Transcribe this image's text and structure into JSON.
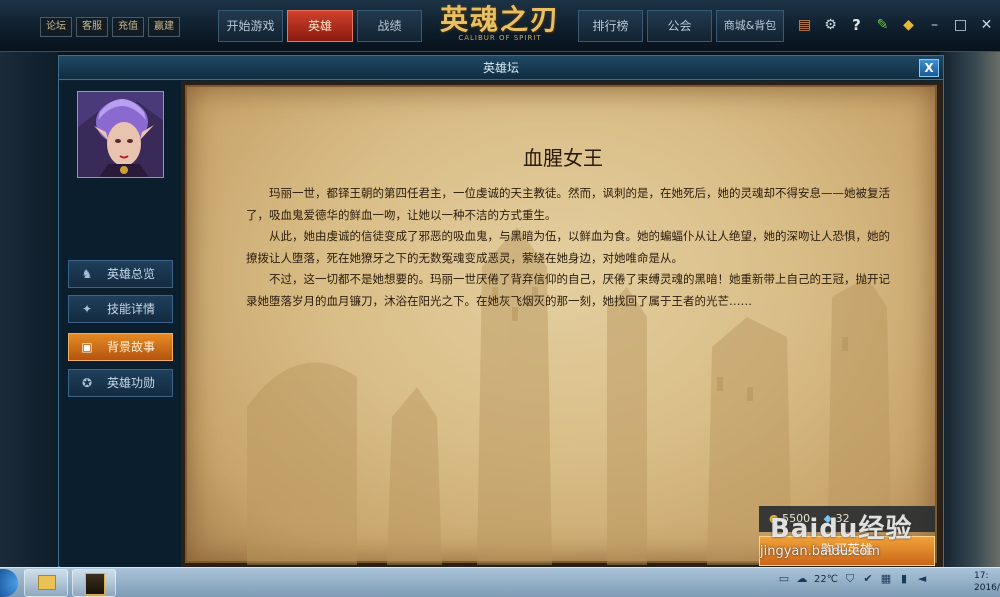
{
  "topbar": {
    "mini_links": [
      "论坛",
      "客服",
      "充值",
      "赢建"
    ],
    "tabs": [
      "开始游戏",
      "英雄",
      "战绩",
      "排行榜",
      "公会",
      "商城&背包"
    ],
    "active_tab": "英雄",
    "logo_text": "英魂之刃",
    "logo_sub": "CALIBUR OF SPIRIT",
    "icons": [
      "notebook-icon",
      "settings-gear-icon",
      "help-question-icon",
      "wrench-icon",
      "diamond-icon",
      "minimize-icon",
      "maximize-icon",
      "close-icon"
    ]
  },
  "dialog": {
    "title": "英雄坛",
    "close_label": "X",
    "menu": [
      {
        "label": "英雄总览",
        "icon": "hero-overview-icon"
      },
      {
        "label": "技能详情",
        "icon": "skill-details-icon"
      },
      {
        "label": "背景故事",
        "icon": "background-story-icon"
      },
      {
        "label": "英雄功勋",
        "icon": "hero-honor-icon"
      }
    ],
    "active_menu": "背景故事",
    "story": {
      "title": "血腥女王",
      "paragraphs": [
        "玛丽一世，都铎王朝的第四任君主，一位虔诚的天主教徒。然而，讽刺的是，在她死后，她的灵魂却不得安息——她被复活了，吸血鬼爱德华的鲜血一吻，让她以一种不洁的方式重生。",
        "从此，她由虔诚的信徒变成了邪恶的吸血鬼，与黑暗为伍，以鲜血为食。她的蝙蝠仆从让人绝望，她的深吻让人恐惧，她的撩拨让人堕落，死在她獠牙之下的无数冤魂变成恶灵，萦绕在她身边，对她唯命是从。",
        "不过，这一切都不是她想要的。玛丽一世厌倦了背弃信仰的自己，厌倦了束缚灵魂的黑暗！她重新带上自己的王冠，抛开记录她堕落岁月的血月镰刀，沐浴在阳光之下。在她灰飞烟灭的那一刻，她找回了属于王者的光芒……"
      ]
    },
    "price_gold": "5500",
    "price_gem": "32",
    "buy_label": "购买英雄"
  },
  "watermark": {
    "brand": "Baidu经验",
    "url": "jingyan.baidu.com"
  },
  "taskbar": {
    "temperature": "22℃",
    "clock_time": "17:",
    "clock_date": "2016/"
  }
}
